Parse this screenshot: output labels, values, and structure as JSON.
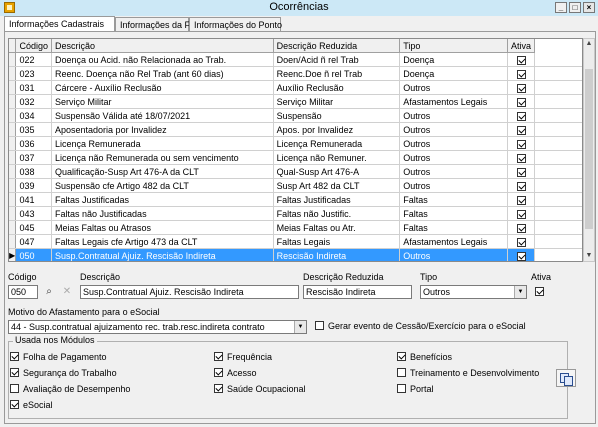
{
  "window": {
    "title": "Ocorrências"
  },
  "tabs": [
    {
      "label": "Informações Cadastrais"
    },
    {
      "label": "Informações da Folha"
    },
    {
      "label": "Informações do Ponto"
    }
  ],
  "grid": {
    "headers": [
      "Código",
      "Descrição",
      "Descrição Reduzida",
      "Tipo",
      "Ativa"
    ],
    "rows": [
      {
        "codigo": "022",
        "descricao": "Doença ou Acid. não Relacionada ao Trab.",
        "reduzida": "Doen/Acid ñ rel Trab",
        "tipo": "Doença",
        "ativa": true
      },
      {
        "codigo": "023",
        "descricao": "Reenc. Doença não Rel Trab (ant 60 dias)",
        "reduzida": "Reenc.Doe ñ rel Trab",
        "tipo": "Doença",
        "ativa": true
      },
      {
        "codigo": "031",
        "descricao": "Cárcere - Auxílio Reclusão",
        "reduzida": "Auxílio Reclusão",
        "tipo": "Outros",
        "ativa": true
      },
      {
        "codigo": "032",
        "descricao": "Serviço Militar",
        "reduzida": "Serviço Militar",
        "tipo": "Afastamentos Legais",
        "ativa": true
      },
      {
        "codigo": "034",
        "descricao": "Suspensão Válida até 18/07/2021",
        "reduzida": "Suspensão",
        "tipo": "Outros",
        "ativa": true
      },
      {
        "codigo": "035",
        "descricao": "Aposentadoria por Invalidez",
        "reduzida": "Apos. por Invalidez",
        "tipo": "Outros",
        "ativa": true
      },
      {
        "codigo": "036",
        "descricao": "Licença Remunerada",
        "reduzida": "Licença Remunerada",
        "tipo": "Outros",
        "ativa": true
      },
      {
        "codigo": "037",
        "descricao": "Licença não Remunerada ou sem vencimento",
        "reduzida": "Licença não Remuner.",
        "tipo": "Outros",
        "ativa": true
      },
      {
        "codigo": "038",
        "descricao": "Qualificação-Susp Art 476-A da CLT",
        "reduzida": "Qual-Susp Art 476-A",
        "tipo": "Outros",
        "ativa": true
      },
      {
        "codigo": "039",
        "descricao": "Suspensão cfe Artigo 482 da CLT",
        "reduzida": "Susp Art 482 da CLT",
        "tipo": "Outros",
        "ativa": true
      },
      {
        "codigo": "041",
        "descricao": "Faltas Justificadas",
        "reduzida": "Faltas Justificadas",
        "tipo": "Faltas",
        "ativa": true
      },
      {
        "codigo": "043",
        "descricao": "Faltas não Justificadas",
        "reduzida": "Faltas não Justific.",
        "tipo": "Faltas",
        "ativa": true
      },
      {
        "codigo": "045",
        "descricao": "Meias Faltas ou Atrasos",
        "reduzida": "Meias Faltas ou Atr.",
        "tipo": "Faltas",
        "ativa": true
      },
      {
        "codigo": "047",
        "descricao": "Faltas Legais cfe Artigo 473 da CLT",
        "reduzida": "Faltas Legais",
        "tipo": "Afastamentos Legais",
        "ativa": true
      },
      {
        "codigo": "050",
        "descricao": "Susp.Contratual Ajuiz. Rescisão Indireta",
        "reduzida": "Rescisão Indireta",
        "tipo": "Outros",
        "ativa": true,
        "selected": true
      }
    ]
  },
  "form": {
    "codigo_label": "Código",
    "codigo_value": "050",
    "descricao_label": "Descrição",
    "descricao_value": "Susp.Contratual Ajuiz. Rescisão Indireta",
    "reduzida_label": "Descrição Reduzida",
    "reduzida_value": "Rescisão Indireta",
    "tipo_label": "Tipo",
    "tipo_value": "Outros",
    "ativa_label": "Ativa",
    "ativa_checked": true,
    "motivo_label": "Motivo do Afastamento para o eSocial",
    "motivo_value": "44 - Susp.contratual ajuizamento rec. trab.resc.indireta contrato",
    "cessao_label": "Gerar evento de Cessão/Exercício para o eSocial",
    "cessao_checked": false
  },
  "modulos": {
    "title": "Usada nos Módulos",
    "items": [
      {
        "label": "Folha de Pagamento",
        "checked": true
      },
      {
        "label": "Frequência",
        "checked": true
      },
      {
        "label": "Benefícios",
        "checked": true
      },
      {
        "label": "Segurança do Trabalho",
        "checked": true
      },
      {
        "label": "Acesso",
        "checked": true
      },
      {
        "label": "Treinamento e Desenvolvimento",
        "checked": false
      },
      {
        "label": "Avaliação de Desempenho",
        "checked": false
      },
      {
        "label": "Saúde Ocupacional",
        "checked": true
      },
      {
        "label": "Portal",
        "checked": false
      },
      {
        "label": "eSocial",
        "checked": true
      }
    ]
  }
}
